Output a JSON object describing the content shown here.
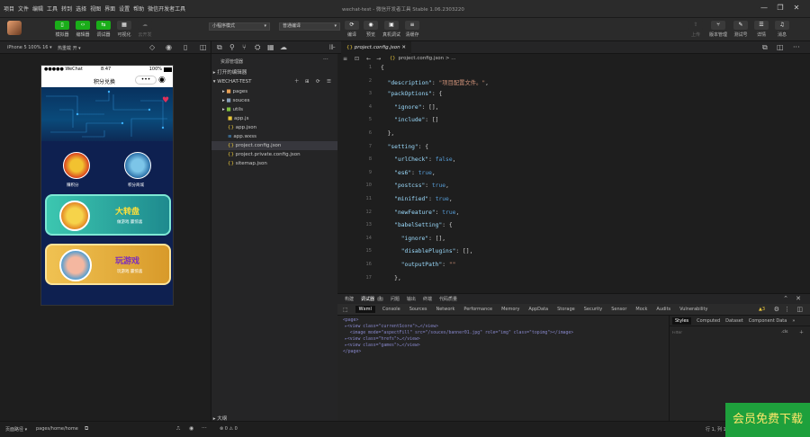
{
  "menu": [
    "项目",
    "文件",
    "编辑",
    "工具",
    "转到",
    "选择",
    "视图",
    "界面",
    "设置",
    "帮助",
    "微信开发者工具"
  ],
  "window_title": "wechat-test - 微信开发者工具 Stable 1.06.2303220",
  "toolbar": {
    "left_buttons": [
      {
        "label": "模拟器",
        "color": "#1aad19"
      },
      {
        "label": "编辑器",
        "color": "#1aad19"
      },
      {
        "label": "调试器",
        "color": "#1aad19"
      },
      {
        "label": "可视化",
        "color": "#3a3a3a"
      },
      {
        "label": "云开发",
        "color": "#3a3a3a"
      }
    ],
    "mode_select": "小程序模式",
    "compile_select": "普通编译",
    "mid_buttons": [
      "编译",
      "预览",
      "真机调试",
      "清缓存"
    ],
    "right_buttons": [
      "上传",
      "版本管理",
      "测试号",
      "详情",
      "消息"
    ]
  },
  "simulator": {
    "device": "iPhone 5 100% 16 ▾",
    "hotreload": "热重载 开 ▾",
    "phone": {
      "carrier": "●●●●● WeChat",
      "time": "8:47",
      "battery": "100%",
      "nav_title": "积分兑换",
      "icons": [
        {
          "label": "赚积分"
        },
        {
          "label": "积分商城"
        }
      ],
      "cards": [
        {
          "title": "大转盘",
          "subtitle": "做游戏 赢惊喜"
        },
        {
          "title": "玩游戏",
          "subtitle": "玩游戏 赢惊喜"
        }
      ]
    }
  },
  "explorer": {
    "title": "资源管理器",
    "open_editors": "打开的编辑器",
    "project": "WECHAT-TEST",
    "items": [
      {
        "name": "pages",
        "type": "folder"
      },
      {
        "name": "souces",
        "type": "folder"
      },
      {
        "name": "utils",
        "type": "folder"
      },
      {
        "name": "app.js",
        "type": "js"
      },
      {
        "name": "app.json",
        "type": "json"
      },
      {
        "name": "app.wxss",
        "type": "wxss"
      },
      {
        "name": "project.config.json",
        "type": "json",
        "selected": true
      },
      {
        "name": "project.private.config.json",
        "type": "json"
      },
      {
        "name": "sitemap.json",
        "type": "json"
      }
    ],
    "outline": "大纲"
  },
  "editor": {
    "tab": "project.config.json",
    "breadcrumb": "project.config.json > ...",
    "lines": [
      {
        "n": "1",
        "text": "{"
      },
      {
        "n": "2",
        "text": "  \"description\": \"项目配置文件。\","
      },
      {
        "n": "3",
        "text": "  \"packOptions\": {"
      },
      {
        "n": "4",
        "text": "    \"ignore\": [],"
      },
      {
        "n": "5",
        "text": "    \"include\": []"
      },
      {
        "n": "6",
        "text": "  },"
      },
      {
        "n": "7",
        "text": "  \"setting\": {"
      },
      {
        "n": "8",
        "text": "    \"urlCheck\": false,"
      },
      {
        "n": "9",
        "text": "    \"es6\": true,"
      },
      {
        "n": "10",
        "text": "    \"postcss\": true,"
      },
      {
        "n": "11",
        "text": "    \"minified\": true,"
      },
      {
        "n": "12",
        "text": "    \"newFeature\": true,"
      },
      {
        "n": "13",
        "text": "    \"babelSetting\": {"
      },
      {
        "n": "14",
        "text": "      \"ignore\": [],"
      },
      {
        "n": "15",
        "text": "      \"disablePlugins\": [],"
      },
      {
        "n": "16",
        "text": "      \"outputPath\": \"\""
      },
      {
        "n": "17",
        "text": "    },"
      }
    ]
  },
  "devtools": {
    "top_tabs": [
      "构建",
      "调试器",
      "问题",
      "输出",
      "终端",
      "代码质量"
    ],
    "debugger_badge": "1",
    "tabs": [
      "Wxml",
      "Console",
      "Sources",
      "Network",
      "Performance",
      "Memory",
      "AppData",
      "Storage",
      "Security",
      "Sensor",
      "Mock",
      "Audits",
      "Vulnerability"
    ],
    "warning_count": "3",
    "dom": [
      "<page>",
      "▸<view class=\"currentScore\">…</view>",
      "  <image mode=\"aspectFill\" src=\"/souces/banner01.jpg\" role=\"img\" class=\"topimg\"></image>",
      "▸<view class=\"hrefs\">…</view>",
      "▸<view class=\"games\">…</view>",
      "</page>"
    ],
    "styles_tabs": [
      "Styles",
      "Computed",
      "Dataset",
      "Component Data"
    ],
    "filter_placeholder": "Filter",
    "cls": ".cls"
  },
  "status": {
    "path_label": "页面路径 ▾",
    "path": "pages/home/home",
    "problems": "⊗ 0 ⚠ 0",
    "right": "行 1, 列 1"
  },
  "watermark": "会员免费下载"
}
